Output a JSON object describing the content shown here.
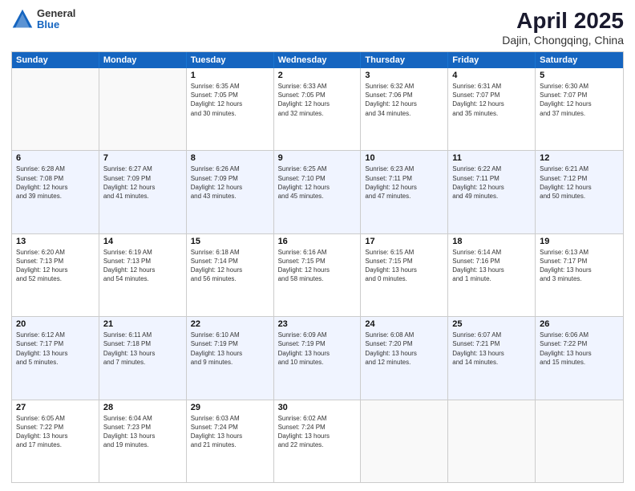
{
  "logo": {
    "line1": "General",
    "line2": "Blue"
  },
  "title": {
    "month_year": "April 2025",
    "location": "Dajin, Chongqing, China"
  },
  "header_days": [
    "Sunday",
    "Monday",
    "Tuesday",
    "Wednesday",
    "Thursday",
    "Friday",
    "Saturday"
  ],
  "rows": [
    {
      "alt": false,
      "cells": [
        {
          "day": "",
          "info": ""
        },
        {
          "day": "",
          "info": ""
        },
        {
          "day": "1",
          "info": "Sunrise: 6:35 AM\nSunset: 7:05 PM\nDaylight: 12 hours\nand 30 minutes."
        },
        {
          "day": "2",
          "info": "Sunrise: 6:33 AM\nSunset: 7:05 PM\nDaylight: 12 hours\nand 32 minutes."
        },
        {
          "day": "3",
          "info": "Sunrise: 6:32 AM\nSunset: 7:06 PM\nDaylight: 12 hours\nand 34 minutes."
        },
        {
          "day": "4",
          "info": "Sunrise: 6:31 AM\nSunset: 7:07 PM\nDaylight: 12 hours\nand 35 minutes."
        },
        {
          "day": "5",
          "info": "Sunrise: 6:30 AM\nSunset: 7:07 PM\nDaylight: 12 hours\nand 37 minutes."
        }
      ]
    },
    {
      "alt": true,
      "cells": [
        {
          "day": "6",
          "info": "Sunrise: 6:28 AM\nSunset: 7:08 PM\nDaylight: 12 hours\nand 39 minutes."
        },
        {
          "day": "7",
          "info": "Sunrise: 6:27 AM\nSunset: 7:09 PM\nDaylight: 12 hours\nand 41 minutes."
        },
        {
          "day": "8",
          "info": "Sunrise: 6:26 AM\nSunset: 7:09 PM\nDaylight: 12 hours\nand 43 minutes."
        },
        {
          "day": "9",
          "info": "Sunrise: 6:25 AM\nSunset: 7:10 PM\nDaylight: 12 hours\nand 45 minutes."
        },
        {
          "day": "10",
          "info": "Sunrise: 6:23 AM\nSunset: 7:11 PM\nDaylight: 12 hours\nand 47 minutes."
        },
        {
          "day": "11",
          "info": "Sunrise: 6:22 AM\nSunset: 7:11 PM\nDaylight: 12 hours\nand 49 minutes."
        },
        {
          "day": "12",
          "info": "Sunrise: 6:21 AM\nSunset: 7:12 PM\nDaylight: 12 hours\nand 50 minutes."
        }
      ]
    },
    {
      "alt": false,
      "cells": [
        {
          "day": "13",
          "info": "Sunrise: 6:20 AM\nSunset: 7:13 PM\nDaylight: 12 hours\nand 52 minutes."
        },
        {
          "day": "14",
          "info": "Sunrise: 6:19 AM\nSunset: 7:13 PM\nDaylight: 12 hours\nand 54 minutes."
        },
        {
          "day": "15",
          "info": "Sunrise: 6:18 AM\nSunset: 7:14 PM\nDaylight: 12 hours\nand 56 minutes."
        },
        {
          "day": "16",
          "info": "Sunrise: 6:16 AM\nSunset: 7:15 PM\nDaylight: 12 hours\nand 58 minutes."
        },
        {
          "day": "17",
          "info": "Sunrise: 6:15 AM\nSunset: 7:15 PM\nDaylight: 13 hours\nand 0 minutes."
        },
        {
          "day": "18",
          "info": "Sunrise: 6:14 AM\nSunset: 7:16 PM\nDaylight: 13 hours\nand 1 minute."
        },
        {
          "day": "19",
          "info": "Sunrise: 6:13 AM\nSunset: 7:17 PM\nDaylight: 13 hours\nand 3 minutes."
        }
      ]
    },
    {
      "alt": true,
      "cells": [
        {
          "day": "20",
          "info": "Sunrise: 6:12 AM\nSunset: 7:17 PM\nDaylight: 13 hours\nand 5 minutes."
        },
        {
          "day": "21",
          "info": "Sunrise: 6:11 AM\nSunset: 7:18 PM\nDaylight: 13 hours\nand 7 minutes."
        },
        {
          "day": "22",
          "info": "Sunrise: 6:10 AM\nSunset: 7:19 PM\nDaylight: 13 hours\nand 9 minutes."
        },
        {
          "day": "23",
          "info": "Sunrise: 6:09 AM\nSunset: 7:19 PM\nDaylight: 13 hours\nand 10 minutes."
        },
        {
          "day": "24",
          "info": "Sunrise: 6:08 AM\nSunset: 7:20 PM\nDaylight: 13 hours\nand 12 minutes."
        },
        {
          "day": "25",
          "info": "Sunrise: 6:07 AM\nSunset: 7:21 PM\nDaylight: 13 hours\nand 14 minutes."
        },
        {
          "day": "26",
          "info": "Sunrise: 6:06 AM\nSunset: 7:22 PM\nDaylight: 13 hours\nand 15 minutes."
        }
      ]
    },
    {
      "alt": false,
      "cells": [
        {
          "day": "27",
          "info": "Sunrise: 6:05 AM\nSunset: 7:22 PM\nDaylight: 13 hours\nand 17 minutes."
        },
        {
          "day": "28",
          "info": "Sunrise: 6:04 AM\nSunset: 7:23 PM\nDaylight: 13 hours\nand 19 minutes."
        },
        {
          "day": "29",
          "info": "Sunrise: 6:03 AM\nSunset: 7:24 PM\nDaylight: 13 hours\nand 21 minutes."
        },
        {
          "day": "30",
          "info": "Sunrise: 6:02 AM\nSunset: 7:24 PM\nDaylight: 13 hours\nand 22 minutes."
        },
        {
          "day": "",
          "info": ""
        },
        {
          "day": "",
          "info": ""
        },
        {
          "day": "",
          "info": ""
        }
      ]
    }
  ]
}
